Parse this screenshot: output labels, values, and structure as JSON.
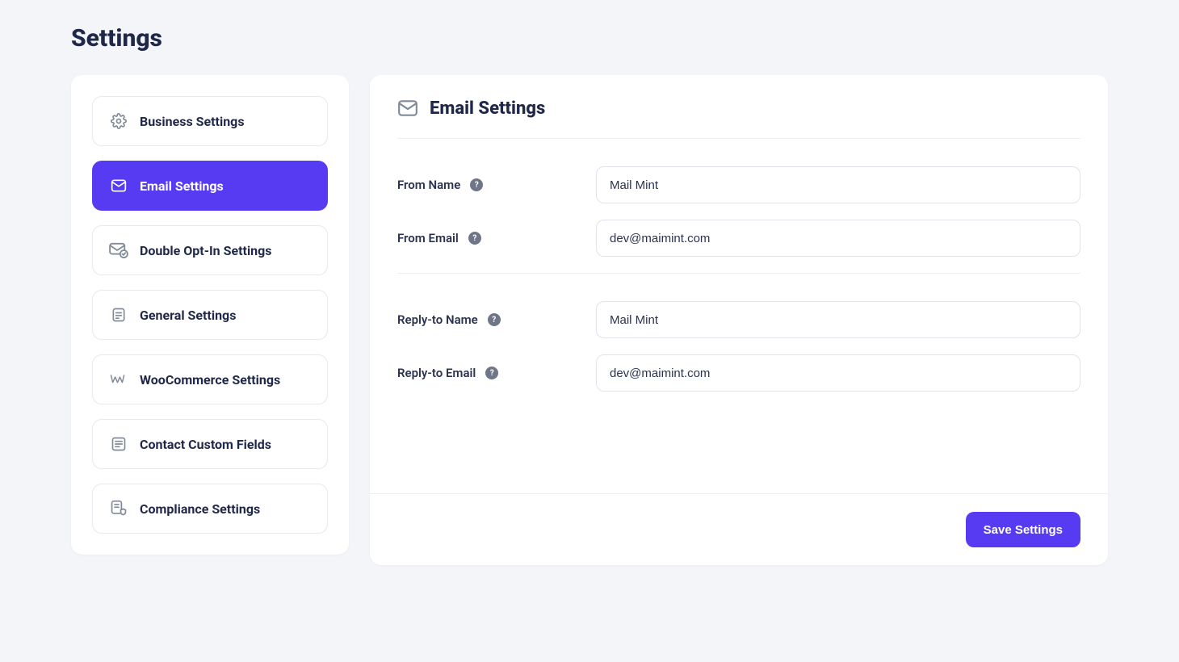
{
  "page": {
    "title": "Settings"
  },
  "sidebar": {
    "items": [
      {
        "label": "Business Settings"
      },
      {
        "label": "Email Settings"
      },
      {
        "label": "Double Opt-In Settings"
      },
      {
        "label": "General Settings"
      },
      {
        "label": "WooCommerce Settings"
      },
      {
        "label": "Contact Custom Fields"
      },
      {
        "label": "Compliance Settings"
      }
    ]
  },
  "panel": {
    "title": "Email Settings",
    "fields": {
      "from_name": {
        "label": "From Name",
        "value": "Mail Mint"
      },
      "from_email": {
        "label": "From Email",
        "value": "dev@maimint.com"
      },
      "reply_to_name": {
        "label": "Reply-to Name",
        "value": "Mail Mint"
      },
      "reply_to_email": {
        "label": "Reply-to Email",
        "value": "dev@maimint.com"
      }
    },
    "save_label": "Save Settings"
  }
}
